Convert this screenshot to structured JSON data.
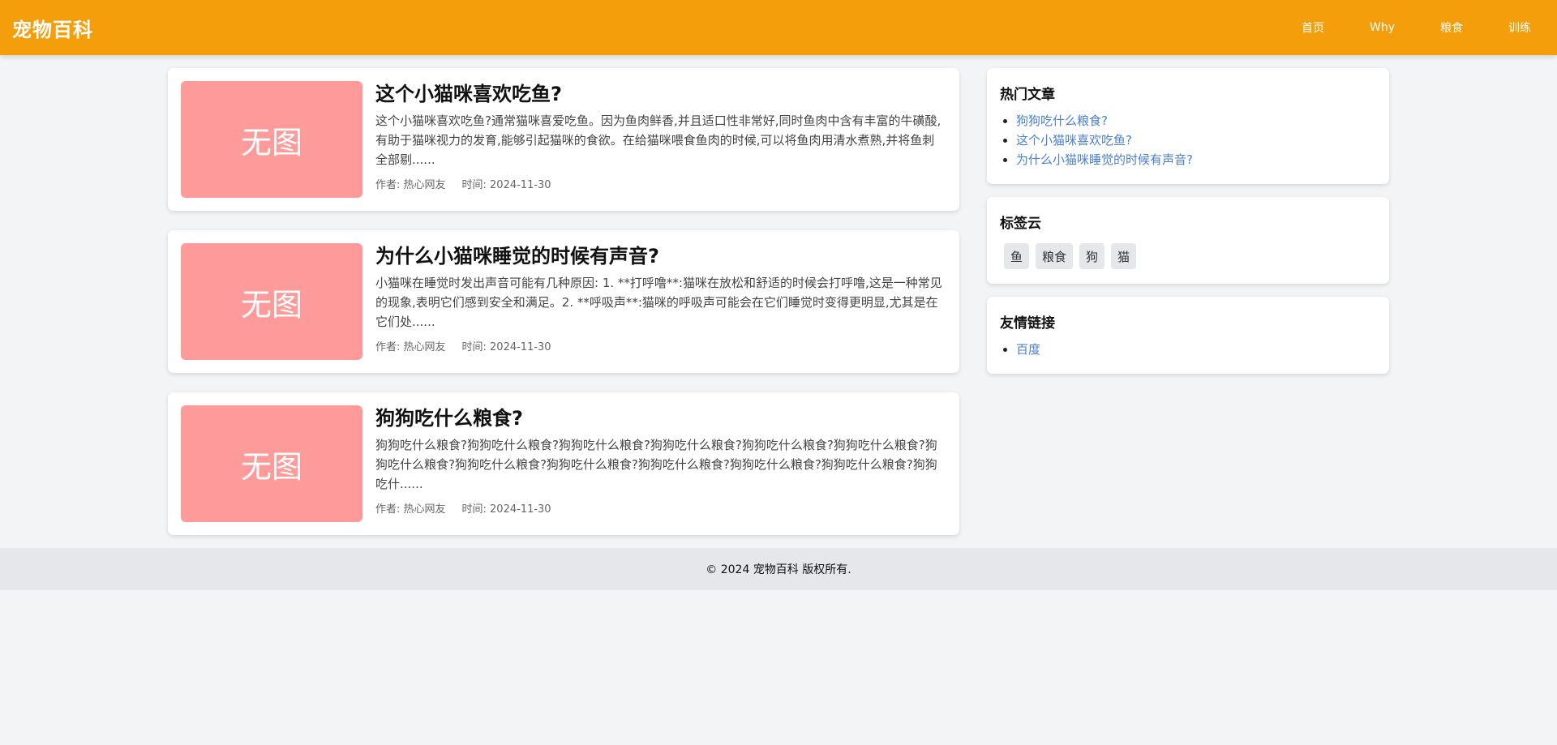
{
  "header": {
    "logo": "宠物百科",
    "nav": [
      {
        "label": "首页"
      },
      {
        "label": "Why"
      },
      {
        "label": "粮食"
      },
      {
        "label": "训练"
      }
    ]
  },
  "articles": [
    {
      "thumb_text": "无图",
      "title": "这个小猫咪喜欢吃鱼?",
      "excerpt": "这个小猫咪喜欢吃鱼?通常猫咪喜爱吃鱼。因为鱼肉鲜香,并且适口性非常好,同时鱼肉中含有丰富的牛磺酸,有助于猫咪视力的发育,能够引起猫咪的食欲。在给猫咪喂食鱼肉的时候,可以将鱼肉用清水煮熟,并将鱼刺全部剔......",
      "author": "作者: 热心网友",
      "time": "时间: 2024-11-30"
    },
    {
      "thumb_text": "无图",
      "title": "为什么小猫咪睡觉的时候有声音?",
      "excerpt": "小猫咪在睡觉时发出声音可能有几种原因: 1. **打呼噜**:猫咪在放松和舒适的时候会打呼噜,这是一种常见的现象,表明它们感到安全和满足。2. **呼吸声**:猫咪的呼吸声可能会在它们睡觉时变得更明显,尤其是在它们处......",
      "author": "作者: 热心网友",
      "time": "时间: 2024-11-30"
    },
    {
      "thumb_text": "无图",
      "title": "狗狗吃什么粮食?",
      "excerpt": "狗狗吃什么粮食?狗狗吃什么粮食?狗狗吃什么粮食?狗狗吃什么粮食?狗狗吃什么粮食?狗狗吃什么粮食?狗狗吃什么粮食?狗狗吃什么粮食?狗狗吃什么粮食?狗狗吃什么粮食?狗狗吃什么粮食?狗狗吃什么粮食?狗狗吃什......",
      "author": "作者: 热心网友",
      "time": "时间: 2024-11-30"
    }
  ],
  "sidebar": {
    "hot": {
      "title": "热门文章",
      "items": [
        {
          "label": "狗狗吃什么粮食?"
        },
        {
          "label": "这个小猫咪喜欢吃鱼?"
        },
        {
          "label": "为什么小猫咪睡觉的时候有声音?"
        }
      ]
    },
    "tags": {
      "title": "标签云",
      "items": [
        {
          "label": "鱼"
        },
        {
          "label": "粮食"
        },
        {
          "label": "狗"
        },
        {
          "label": "猫"
        }
      ]
    },
    "links": {
      "title": "友情链接",
      "items": [
        {
          "label": "百度"
        }
      ]
    }
  },
  "footer": {
    "text": "© 2024 宠物百科 版权所有."
  },
  "colors": {
    "header_bg": "#f59e0b",
    "thumb_bg": "#fd9a9a",
    "link": "#4a7fd4"
  }
}
